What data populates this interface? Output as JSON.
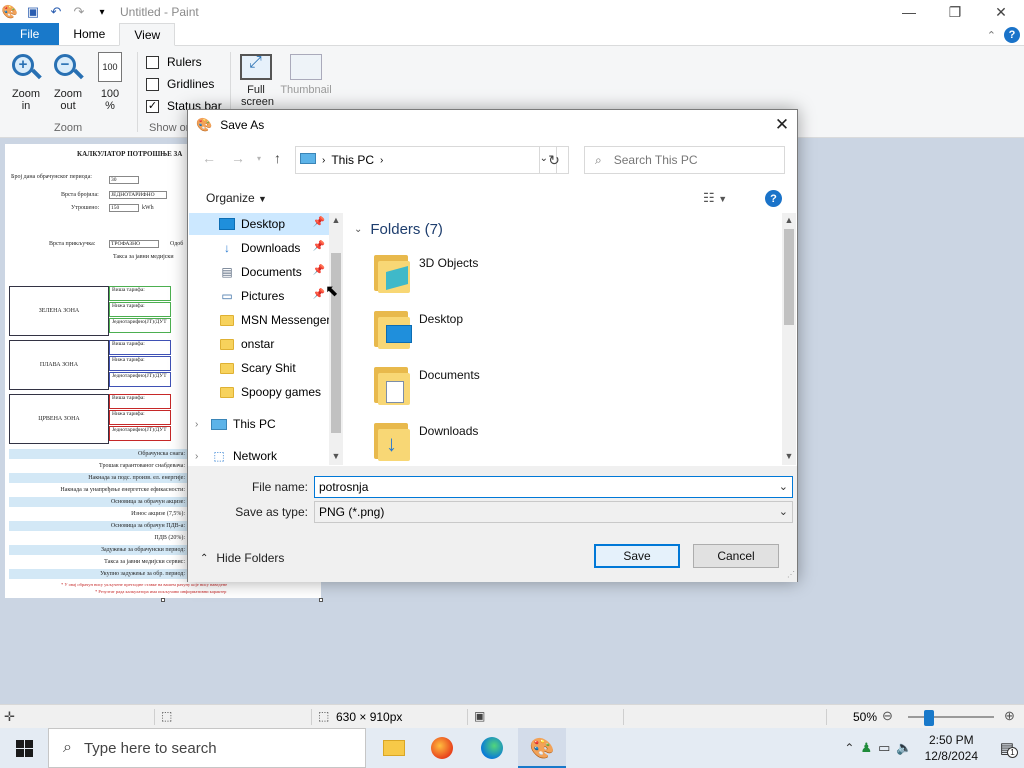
{
  "window": {
    "title": "Untitled - Paint",
    "controls": {
      "minimize": "—",
      "maximize": "❐",
      "close": "✕"
    }
  },
  "ribbon": {
    "tabs": [
      {
        "label": "File"
      },
      {
        "label": "Home"
      },
      {
        "label": "View"
      }
    ],
    "active_tab": "View",
    "zoom_group": {
      "label": "Zoom",
      "zoom_in": "Zoom in",
      "zoom_out": "Zoom out",
      "hundred": "100 %"
    },
    "show_group": {
      "label": "Show or hide",
      "rulers": {
        "label": "Rulers",
        "checked": false
      },
      "gridlines": {
        "label": "Gridlines",
        "checked": false
      },
      "status_bar": {
        "label": "Status bar",
        "checked": true
      }
    },
    "display_group": {
      "full_screen": "Full screen",
      "thumbnail": "Thumbnail"
    }
  },
  "canvas": {
    "document_title": "КАЛКУЛАТОР ПОТРОШЊЕ ЗА",
    "fields": {
      "billing_days_label": "Број дана обрачунског периода:",
      "billing_days_value": "30",
      "meter_type_label": "Врста бројила:",
      "meter_type_value": "ЈЕДНОТАРИФНО",
      "consumed_label": "Утрошено:",
      "consumed_value": "150",
      "consumed_unit": "kWh",
      "connection_type_label": "Врста прикључка:",
      "connection_type_value": "ТРОФАЗНО",
      "approved_label": "Одоб",
      "public_media_label": "Такса за јавни медијски"
    },
    "zones": [
      {
        "name": "ЗЕЛЕНА ЗОНА",
        "rows": [
          "Виша тарифа:",
          "Нижа тарифа:",
          "Једнотарифно(ЈТ)/ДУТ"
        ],
        "color": "#4caf50"
      },
      {
        "name": "ПЛАВА ЗОНА",
        "rows": [
          "Виша тарифа:",
          "Нижа тарифа:",
          "Једнотарифно(ЈТ)/ДУТ"
        ],
        "color": "#3f51b5"
      },
      {
        "name": "ЦРВЕНА ЗОНА",
        "rows": [
          "Виша тарифа:",
          "Нижа тарифа:",
          "Једнотарифно(ЈТ)/ДУТ"
        ],
        "color": "#c62828"
      }
    ],
    "summary_rows": [
      {
        "label": "Обрачунска снага:",
        "shaded": true
      },
      {
        "label": "Трошак гарантованог снабдевача:",
        "shaded": false
      },
      {
        "label": "Накнада за подс. произв. ел. енергије:",
        "shaded": true
      },
      {
        "label": "Накнада за унапређење енергетске ефикасности:",
        "shaded": false
      },
      {
        "label": "Основица за обрачун акцизе:",
        "shaded": true
      },
      {
        "label": "Износ акцизе (7,5%):",
        "shaded": false
      },
      {
        "label": "Основица за обрачун ПДВ-а:",
        "shaded": true
      },
      {
        "label": "ПДВ (20%):",
        "shaded": false
      },
      {
        "label": "Задужење за обрачунски период:",
        "shaded": true
      },
      {
        "label": "Такса за јавни медијски сервис:",
        "shaded": false
      },
      {
        "label": "Укупно задужење за обр. период:",
        "shaded": true
      }
    ],
    "footnotes": [
      "* У овај обрачун нису укључене претходне ставке на вашем рачуну које нису наведене",
      "* Резултат рада калкулатора има искључиво информативни карактер"
    ]
  },
  "dialog": {
    "title": "Save As",
    "address": {
      "root_label": "This PC"
    },
    "search_placeholder": "Search This PC",
    "organize": "Organize",
    "nav_items": [
      {
        "label": "Desktop",
        "selected": true,
        "pinned": true,
        "icon": "desktop-icon"
      },
      {
        "label": "Downloads",
        "selected": false,
        "pinned": true,
        "icon": "download-icon"
      },
      {
        "label": "Documents",
        "selected": false,
        "pinned": true,
        "icon": "document-icon"
      },
      {
        "label": "Pictures",
        "selected": false,
        "pinned": true,
        "icon": "picture-icon"
      },
      {
        "label": "MSN Messenger",
        "selected": false,
        "pinned": false,
        "icon": "folder-icon"
      },
      {
        "label": "onstar",
        "selected": false,
        "pinned": false,
        "icon": "folder-icon"
      },
      {
        "label": "Scary Shit",
        "selected": false,
        "pinned": false,
        "icon": "folder-icon"
      },
      {
        "label": "Spoopy games",
        "selected": false,
        "pinned": false,
        "icon": "folder-icon"
      },
      {
        "label": "This PC",
        "selected": false,
        "pinned": false,
        "icon": "pc-icon"
      },
      {
        "label": "Network",
        "selected": false,
        "pinned": false,
        "icon": "network-icon"
      }
    ],
    "folders_header": "Folders (7)",
    "folders": [
      {
        "name": "3D Objects",
        "icon": "3d-objects-icon"
      },
      {
        "name": "Desktop",
        "icon": "desktop-icon"
      },
      {
        "name": "Documents",
        "icon": "document-icon"
      },
      {
        "name": "Downloads",
        "icon": "download-icon"
      }
    ],
    "file_name_label": "File name:",
    "file_name_value": "potrosnja",
    "save_type_label": "Save as type:",
    "save_type_value": "PNG (*.png)",
    "hide_folders": "Hide Folders",
    "save_button": "Save",
    "cancel_button": "Cancel"
  },
  "statusbar": {
    "dimensions": "630 × 910px",
    "zoom": "50%",
    "zoom_level": 0.5
  },
  "taskbar": {
    "search_placeholder": "Type here to search",
    "time": "2:50 PM",
    "date": "12/8/2024",
    "notification_count": "1"
  },
  "colors": {
    "accent": "#1979ca",
    "selection": "#cce8ff",
    "workspace": "#cbd5e3"
  }
}
